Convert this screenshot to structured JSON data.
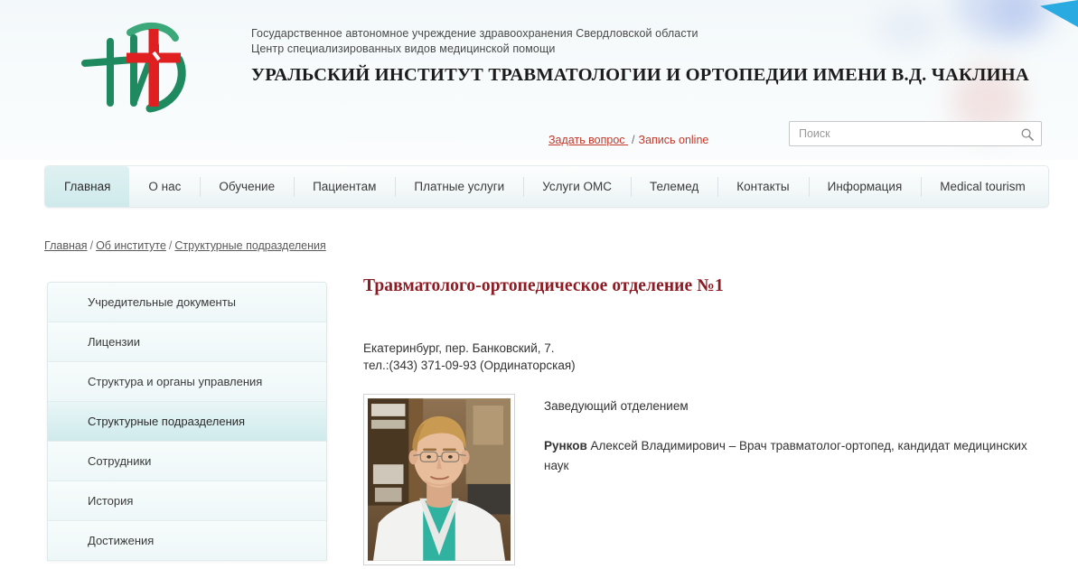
{
  "header": {
    "org_line1": "Государственное автономное учреждение здравоохранения Свердловской области",
    "org_line2": "Центр специализированных видов медицинской помощи",
    "institute_title": "УРАЛЬСКИЙ ИНСТИТУТ ТРАВМАТОЛОГИИ И ОРТОПЕДИИ ИМЕНИ В.Д. ЧАКЛИНА",
    "logo_alt": "НИТО"
  },
  "toplinks": {
    "ask_question": "Задать вопрос ",
    "separator": "/",
    "online_booking": "Запись online"
  },
  "search": {
    "placeholder": "Поиск",
    "value": ""
  },
  "nav": {
    "items": [
      {
        "label": "Главная",
        "active": true
      },
      {
        "label": "О нас",
        "active": false
      },
      {
        "label": "Обучение",
        "active": false
      },
      {
        "label": "Пациентам",
        "active": false
      },
      {
        "label": "Платные услуги",
        "active": false
      },
      {
        "label": "Услуги ОМС",
        "active": false
      },
      {
        "label": "Телемед",
        "active": false
      },
      {
        "label": "Контакты",
        "active": false
      },
      {
        "label": "Информация",
        "active": false
      },
      {
        "label": "Medical tourism",
        "active": false
      }
    ]
  },
  "breadcrumb": {
    "items": [
      "Главная",
      "Об институте",
      "Структурные подразделения"
    ],
    "separator": "/"
  },
  "sidebar": {
    "items": [
      {
        "label": "Учредительные документы",
        "active": false
      },
      {
        "label": "Лицензии",
        "active": false
      },
      {
        "label": "Структура и органы управления",
        "active": false
      },
      {
        "label": "Структурные подразделения",
        "active": true
      },
      {
        "label": "Сотрудники",
        "active": false
      },
      {
        "label": "История",
        "active": false
      },
      {
        "label": "Достижения",
        "active": false
      }
    ]
  },
  "main": {
    "title": "Травматолого-ортопедическое отделение №1",
    "address_line1": "Екатеринбург, пер. Банковский, 7.",
    "address_line2": "тел.:(343) 371-09-93 (Ординаторская)",
    "doctor": {
      "role": "Заведующий отделением",
      "surname": "Рунков",
      "rest": " Алексей Владимирович – Врач травматолог-ортопед, кандидат медицинских наук",
      "photo_alt": "Фотография заведующего отделением"
    }
  },
  "colors": {
    "accent_red": "#c0392b",
    "title_dark_red": "#8e1b23",
    "active_teal": "#cfeaec",
    "logo_green": "#1f8a5f",
    "logo_red": "#e02020",
    "corner_blue": "#29abe2"
  }
}
